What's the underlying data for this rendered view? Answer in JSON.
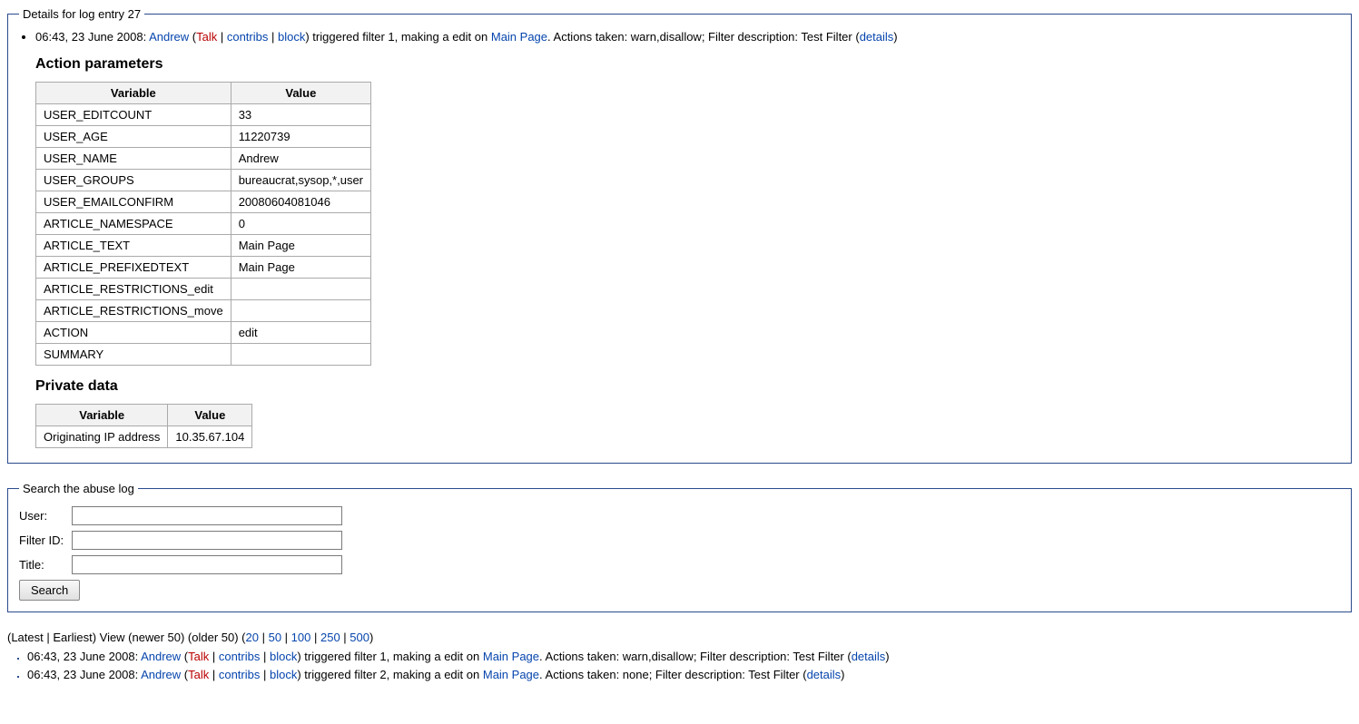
{
  "details_fieldset": {
    "legend": "Details for log entry 27",
    "summary": {
      "timestamp": "06:43, 23 June 2008",
      "user": "Andrew",
      "talk": "Talk",
      "contribs": "contribs",
      "block": "block",
      "triggered_prefix": " triggered filter 1, making a edit on ",
      "page": "Main Page",
      "after_page": ". Actions taken: warn,disallow; Filter description: Test Filter (",
      "details": "details",
      "close": ")"
    },
    "action_parameters_heading": "Action parameters",
    "action_table": {
      "headers": {
        "variable": "Variable",
        "value": "Value"
      },
      "rows": [
        {
          "variable": "USER_EDITCOUNT",
          "value": "33"
        },
        {
          "variable": "USER_AGE",
          "value": "11220739"
        },
        {
          "variable": "USER_NAME",
          "value": "Andrew"
        },
        {
          "variable": "USER_GROUPS",
          "value": "bureaucrat,sysop,*,user"
        },
        {
          "variable": "USER_EMAILCONFIRM",
          "value": "20080604081046"
        },
        {
          "variable": "ARTICLE_NAMESPACE",
          "value": "0"
        },
        {
          "variable": "ARTICLE_TEXT",
          "value": "Main Page"
        },
        {
          "variable": "ARTICLE_PREFIXEDTEXT",
          "value": "Main Page"
        },
        {
          "variable": "ARTICLE_RESTRICTIONS_edit",
          "value": ""
        },
        {
          "variable": "ARTICLE_RESTRICTIONS_move",
          "value": ""
        },
        {
          "variable": "ACTION",
          "value": "edit"
        },
        {
          "variable": "SUMMARY",
          "value": ""
        }
      ]
    },
    "private_data_heading": "Private data",
    "private_table": {
      "headers": {
        "variable": "Variable",
        "value": "Value"
      },
      "rows": [
        {
          "variable": "Originating IP address",
          "value": "10.35.67.104"
        }
      ]
    }
  },
  "search_fieldset": {
    "legend": "Search the abuse log",
    "labels": {
      "user": "User:",
      "filter_id": "Filter ID:",
      "title": "Title:"
    },
    "button": "Search"
  },
  "pager": {
    "latest_earliest": "(Latest | Earliest) View (newer 50) (older 50) (",
    "links": [
      "20",
      "50",
      "100",
      "250",
      "500"
    ],
    "close": ")"
  },
  "log_list": [
    {
      "timestamp": "06:43, 23 June 2008",
      "user": "Andrew",
      "talk": "Talk",
      "contribs": "contribs",
      "block": "block",
      "triggered_text": " triggered filter 1, making a edit on ",
      "page": "Main Page",
      "after_page": ". Actions taken: warn,disallow; Filter description: Test Filter (",
      "details": "details",
      "close": ")"
    },
    {
      "timestamp": "06:43, 23 June 2008",
      "user": "Andrew",
      "talk": "Talk",
      "contribs": "contribs",
      "block": "block",
      "triggered_text": " triggered filter 2, making a edit on ",
      "page": "Main Page",
      "after_page": ". Actions taken: none; Filter description: Test Filter (",
      "details": "details",
      "close": ")"
    }
  ]
}
